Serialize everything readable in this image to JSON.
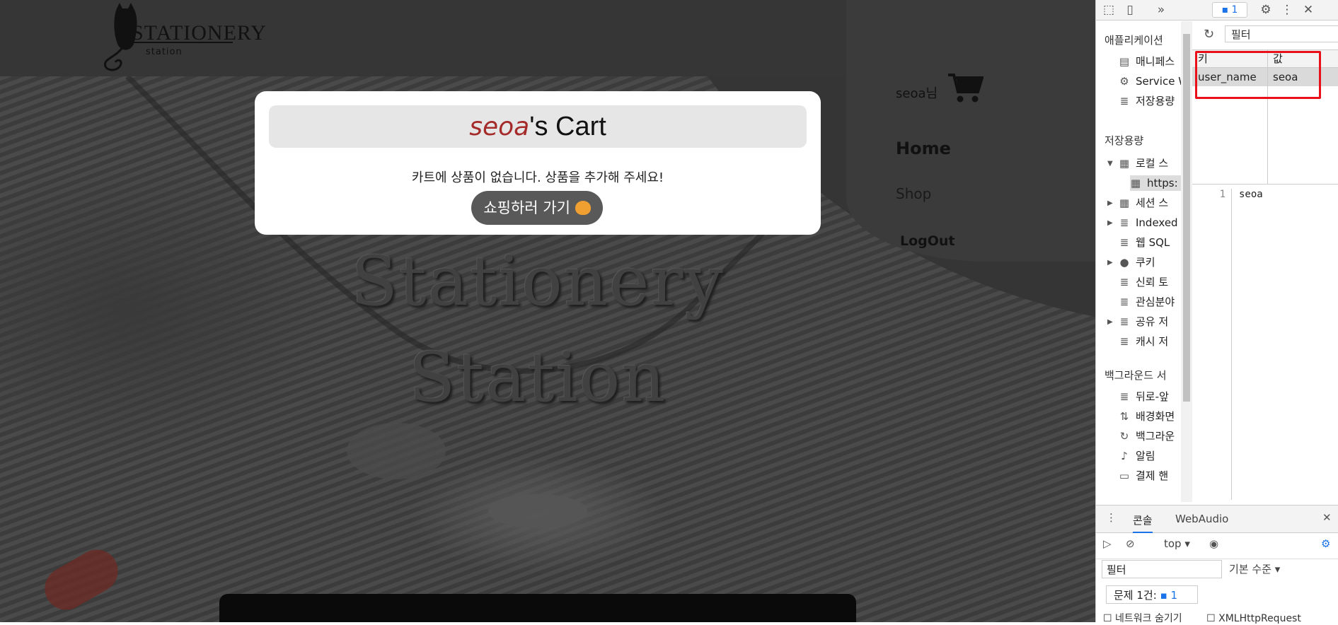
{
  "site": {
    "logo_text": "STATIONERY",
    "logo_sub": "station",
    "close_label": "X",
    "user_greeting": "seoa님",
    "nav": {
      "home": "Home",
      "shop": "Shop",
      "logout": "LogOut"
    },
    "hero_line1": "Stationery",
    "hero_line2": "Station"
  },
  "modal": {
    "user_name": "seoa",
    "title_suffix": "'s Cart",
    "empty_message": "카트에 상품이 없습니다. 상품을 추가해 주세요!",
    "shop_button": "쇼핑하러 가기"
  },
  "devtools": {
    "issues_badge": "1",
    "left_panel": {
      "app_section": "애플리케이션",
      "app_items": [
        "매니페스",
        "Service W",
        "저장용량"
      ],
      "storage_section": "저장용량",
      "storage_items": [
        "로컬 스",
        "https:",
        "세션 스",
        "Indexed",
        "웹 SQL",
        "쿠키",
        "신뢰 토",
        "관심분야",
        "공유 저",
        "캐시 저"
      ],
      "background_section": "백그라운드 서",
      "background_items": [
        "뒤로-앞",
        "배경화면",
        "백그라운",
        "알림",
        "결제 핸"
      ]
    },
    "filter_placeholder": "필터",
    "table": {
      "key_header": "키",
      "value_header": "값",
      "rows": [
        {
          "key": "user_name",
          "value": "seoa"
        }
      ]
    },
    "preview": {
      "line": "1",
      "value": "seoa"
    },
    "console": {
      "tab_console": "콘솔",
      "tab_webaudio": "WebAudio",
      "context": "top",
      "filter_placeholder": "필터",
      "level": "기본 수준",
      "issues_text": "문제 1건:",
      "issues_count": "1",
      "hide_network": "네트워크 숨기기",
      "xhr": "XMLHttpRequest"
    }
  }
}
